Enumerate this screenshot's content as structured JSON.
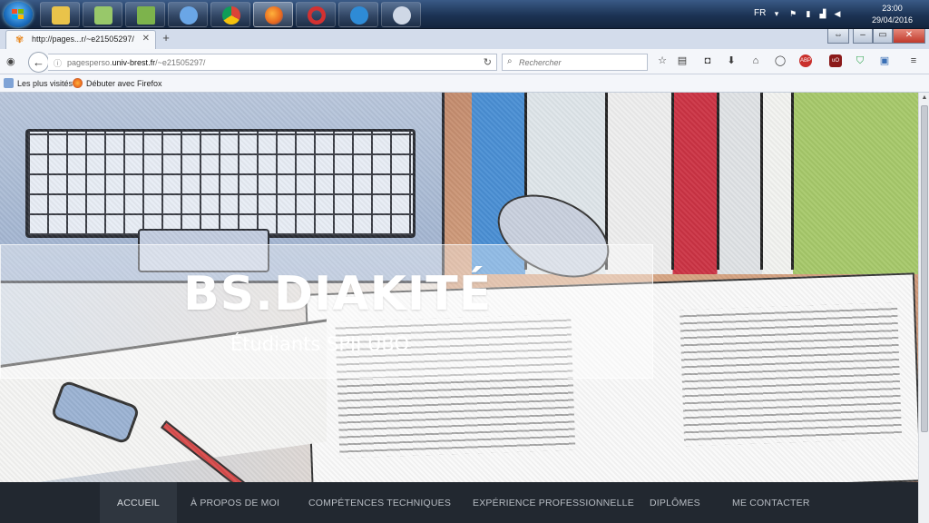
{
  "taskbar": {
    "language": "FR",
    "time": "23:00",
    "date": "29/04/2016",
    "apps": [
      {
        "name": "explorer-taskbar-icon",
        "color": "#e9c34a"
      },
      {
        "name": "folder-taskbar-icon",
        "color": "#98c86a"
      },
      {
        "name": "chart-taskbar-icon",
        "color": "#7db34c"
      },
      {
        "name": "safari-taskbar-icon",
        "color": "#6aa6e6"
      },
      {
        "name": "chrome-taskbar-icon",
        "color": "#e6c33a"
      },
      {
        "name": "firefox-taskbar-icon",
        "color": "#e8871e"
      },
      {
        "name": "opera-taskbar-icon",
        "color": "#d33131"
      },
      {
        "name": "ie-taskbar-icon",
        "color": "#2e8bd6"
      },
      {
        "name": "paint-taskbar-icon",
        "color": "#cfd8e6"
      }
    ]
  },
  "browser": {
    "tab_title": "http://pages...r/~e21505297/",
    "url_prefix": "pagesperso.",
    "url_domain": "univ-brest.fr",
    "url_path": "/~e21505297/",
    "search_placeholder": "Rechercher",
    "bookmarks": [
      "Les plus visités",
      "Débuter avec Firefox"
    ]
  },
  "page": {
    "title": "BS.DIAKITÉ",
    "subtitle": "Étudiants SPII UBO",
    "menu": [
      "ACCUEIL",
      "À PROPOS DE MOI",
      "COMPÉTENCES TECHNIQUES",
      "EXPÉRIENCE PROFESSIONNELLE",
      "DIPLÔMES",
      "ME CONTACTER"
    ]
  },
  "colors": {
    "menu_bg": "#222830",
    "menu_active": "#2f363f",
    "menu_text": "#b8bdc4",
    "firefox_orange": "#e8871e"
  }
}
